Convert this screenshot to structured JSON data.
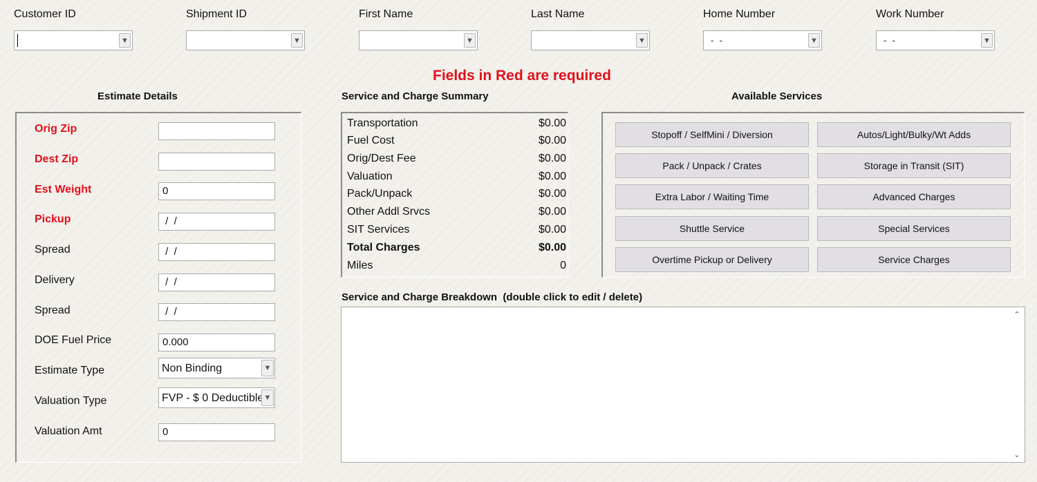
{
  "top_fields": [
    {
      "label": "Customer ID",
      "value": ""
    },
    {
      "label": "Shipment ID",
      "value": ""
    },
    {
      "label": "First Name",
      "value": ""
    },
    {
      "label": "Last Name",
      "value": ""
    },
    {
      "label": "Home Number",
      "value": " -  -"
    },
    {
      "label": "Work Number",
      "value": " -  -"
    }
  ],
  "required_note": "Fields in Red are required",
  "estimate": {
    "title": "Estimate Details",
    "orig_zip": {
      "label": "Orig Zip",
      "value": ""
    },
    "dest_zip": {
      "label": "Dest Zip",
      "value": ""
    },
    "est_weight": {
      "label": "Est Weight",
      "value": "0"
    },
    "pickup": {
      "label": "Pickup",
      "value": " /  /"
    },
    "spread1": {
      "label": "Spread",
      "value": " /  /"
    },
    "delivery": {
      "label": "Delivery",
      "value": " /  /"
    },
    "spread2": {
      "label": "Spread",
      "value": " /  /"
    },
    "doe_fuel": {
      "label": "DOE Fuel Price",
      "value": "0.000"
    },
    "estimate_type": {
      "label": "Estimate Type",
      "value": "Non Binding"
    },
    "valuation_type": {
      "label": "Valuation Type",
      "value": "FVP - $ 0 Deductible"
    },
    "valuation_amt": {
      "label": "Valuation Amt",
      "value": "0"
    }
  },
  "summary": {
    "title": "Service and Charge Summary",
    "rows": [
      {
        "label": "Transportation",
        "amount": "$0.00"
      },
      {
        "label": "Fuel Cost",
        "amount": "$0.00"
      },
      {
        "label": "Orig/Dest Fee",
        "amount": "$0.00"
      },
      {
        "label": "Valuation",
        "amount": "$0.00"
      },
      {
        "label": "Pack/Unpack",
        "amount": "$0.00"
      },
      {
        "label": "Other Addl Srvcs",
        "amount": "$0.00"
      },
      {
        "label": "SIT Services",
        "amount": "$0.00"
      },
      {
        "label": "Total Charges",
        "amount": "$0.00"
      },
      {
        "label": "Miles",
        "amount": "0"
      }
    ]
  },
  "services": {
    "title": "Available Services",
    "buttons": [
      "Stopoff / SelfMini / Diversion",
      "Autos/Light/Bulky/Wt Adds",
      "Pack / Unpack / Crates",
      "Storage in Transit (SIT)",
      "Extra Labor / Waiting Time",
      "Advanced Charges",
      "Shuttle Service",
      "Special Services",
      "Overtime Pickup or Delivery",
      "Service Charges"
    ]
  },
  "breakdown": {
    "title": "Service and Charge Breakdown  (double click to edit / delete)"
  },
  "icons": {
    "dropdown": "chevron-down-icon",
    "scroll_up": "scroll-up-icon",
    "scroll_down": "scroll-down-icon"
  },
  "colors": {
    "required": "#e0101c",
    "button_bg": "#e2dfe4"
  }
}
